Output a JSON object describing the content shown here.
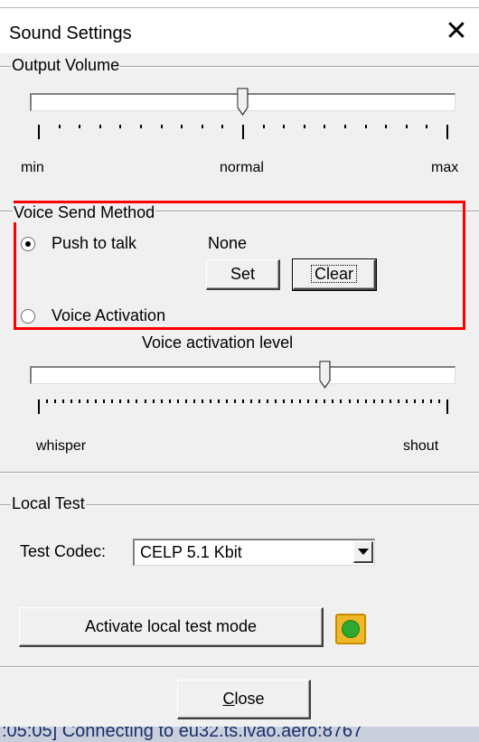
{
  "window": {
    "title": "Sound Settings",
    "close_glyph": "✕"
  },
  "output_volume": {
    "label": "Output Volume",
    "level_percent": 50,
    "labels": {
      "min": "min",
      "normal": "normal",
      "max": "max"
    }
  },
  "voice_send": {
    "label": "Voice Send Method",
    "push_to_talk": {
      "label": "Push to talk",
      "selected": true
    },
    "key_binding": "None",
    "set_button": "Set",
    "clear_button": "Clear",
    "voice_activation": {
      "label": "Voice Activation",
      "selected": false
    }
  },
  "voice_activation_level": {
    "label": "Voice activation level",
    "level_percent": 70,
    "labels": {
      "low": "whisper",
      "high": "shout"
    }
  },
  "local_test": {
    "label": "Local Test",
    "codec_label": "Test Codec:",
    "codec_value": "CELP 5.1 Kbit",
    "activate_button": "Activate local test mode",
    "indicator_color": "#2fa82f"
  },
  "close_button": {
    "mnemonic": "C",
    "rest": "lose"
  },
  "status": {
    "text": ":05:05] Connecting to eu32.ts.ivao.aero:8767"
  },
  "colors": {
    "highlight_box": "#ff0000"
  }
}
